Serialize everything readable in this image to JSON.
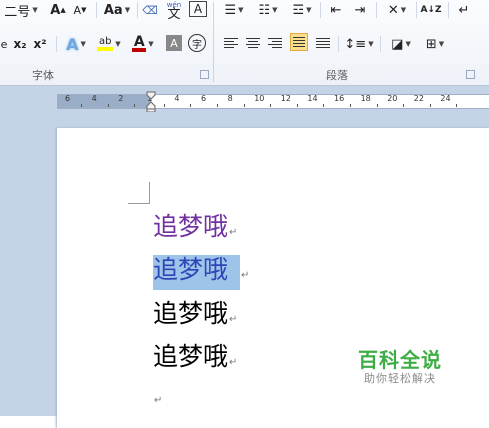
{
  "ribbon": {
    "font_group_label": "字体",
    "paragraph_group_label": "段落",
    "font_size_partial": "二号",
    "change_case_label": "Aa",
    "phonetic_label": "wén",
    "phonetic_char": "文",
    "char_border_label": "A",
    "grow_font_label": "A",
    "shrink_font_label": "A",
    "subscript_label": "x₂",
    "superscript_label": "x²",
    "text_effect_label": "A",
    "highlight_label": "ab",
    "font_color_label": "A",
    "char_shading_label": "A",
    "enclose_char_label": "字",
    "sort_label": "A↓Z",
    "highlight_color": "#ffff00",
    "font_color": "#c00000"
  },
  "ruler": {
    "ticks": [
      "6",
      "4",
      "2",
      "2",
      "4",
      "6",
      "8",
      "10",
      "12",
      "14",
      "16",
      "18",
      "20",
      "22",
      "24"
    ]
  },
  "document": {
    "lines": [
      {
        "text": "追梦哦",
        "color": "#7030a0"
      },
      {
        "text": "追梦哦",
        "color": "#2f45b6",
        "selected": true
      },
      {
        "text": "追梦哦",
        "color": "#000000"
      },
      {
        "text": "追梦哦",
        "color": "#000000"
      }
    ],
    "paragraph_mark": "↵"
  },
  "watermark": {
    "title": "百科全说",
    "subtitle": "助你轻松解决"
  }
}
